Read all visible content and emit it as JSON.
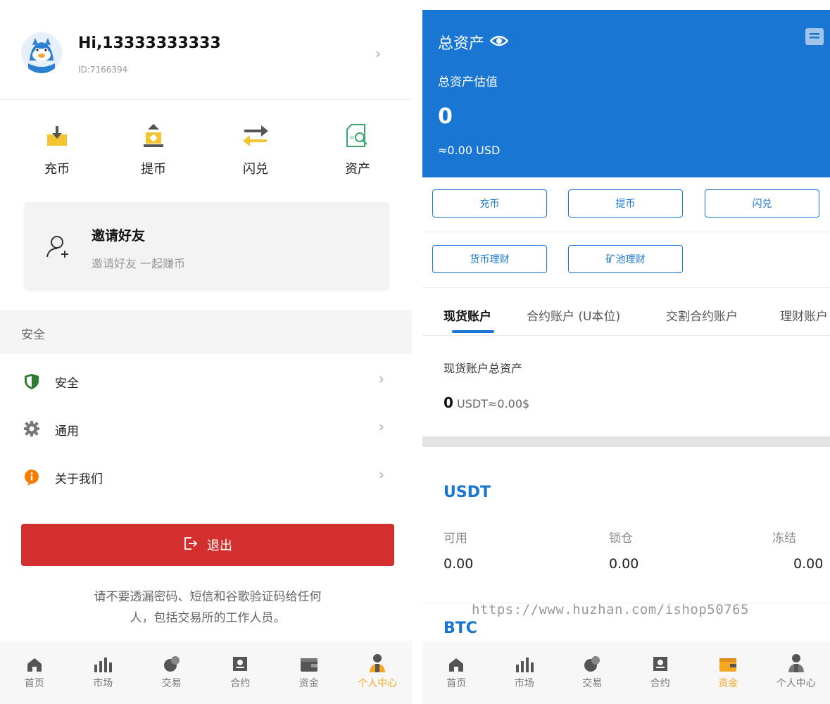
{
  "left": {
    "user": {
      "name": "Hi,13333333333",
      "id": "ID:7166394"
    },
    "quick_actions": [
      {
        "label": "充币",
        "icon": "deposit-icon"
      },
      {
        "label": "提币",
        "icon": "withdraw-icon"
      },
      {
        "label": "闪兑",
        "icon": "swap-icon"
      },
      {
        "label": "资产",
        "icon": "assets-icon"
      }
    ],
    "invite": {
      "title": "邀请好友",
      "subtitle": "邀请好友 一起赚币"
    },
    "section_header": "安全",
    "menu": [
      {
        "label": "安全",
        "icon": "shield-icon"
      },
      {
        "label": "通用",
        "icon": "gear-icon"
      },
      {
        "label": "关于我们",
        "icon": "info-icon"
      }
    ],
    "logout_label": "退出",
    "warning_line1": "请不要透漏密码、短信和谷歌验证码给任何",
    "warning_line2": "人，包括交易所的工作人员。",
    "nav": [
      {
        "label": "首页",
        "icon": "home-icon"
      },
      {
        "label": "市场",
        "icon": "market-icon"
      },
      {
        "label": "交易",
        "icon": "trade-icon"
      },
      {
        "label": "合约",
        "icon": "contract-icon"
      },
      {
        "label": "资金",
        "icon": "wallet-icon"
      },
      {
        "label": "个人中心",
        "icon": "profile-icon"
      }
    ],
    "active_nav": "个人中心"
  },
  "right": {
    "hero": {
      "title": "总资产",
      "subtitle": "总资产估值",
      "value": "0",
      "usd": "≈0.00 USD"
    },
    "buttons_row1": [
      "充币",
      "提币",
      "闪兑"
    ],
    "buttons_row2": [
      "货币理财",
      "矿池理财"
    ],
    "tabs": [
      "现货账户",
      "合约账户 (U本位)",
      "交割合约账户",
      "理财账户"
    ],
    "active_tab": "现货账户",
    "spot_title": "现货账户总资产",
    "spot_amount": "0",
    "spot_unit": "USDT≈0.00$",
    "coins": [
      {
        "name": "USDT",
        "cols": [
          {
            "label": "可用",
            "value": "0.00"
          },
          {
            "label": "锁仓",
            "value": "0.00"
          },
          {
            "label": "冻结",
            "value": "0.00"
          }
        ]
      },
      {
        "name": "BTC"
      }
    ],
    "watermark": "https://www.huzhan.com/ishop50765",
    "nav": [
      {
        "label": "首页"
      },
      {
        "label": "市场"
      },
      {
        "label": "交易"
      },
      {
        "label": "合约"
      },
      {
        "label": "资金"
      },
      {
        "label": "个人中心"
      }
    ],
    "active_nav": "资金"
  },
  "colors": {
    "primary_blue": "#1976d2",
    "logout_red": "#d32f2f",
    "active_orange": "#f5a623",
    "shield_green": "#2e7d32",
    "info_orange": "#f57c00",
    "deposit_yellow": "#f4c430"
  }
}
